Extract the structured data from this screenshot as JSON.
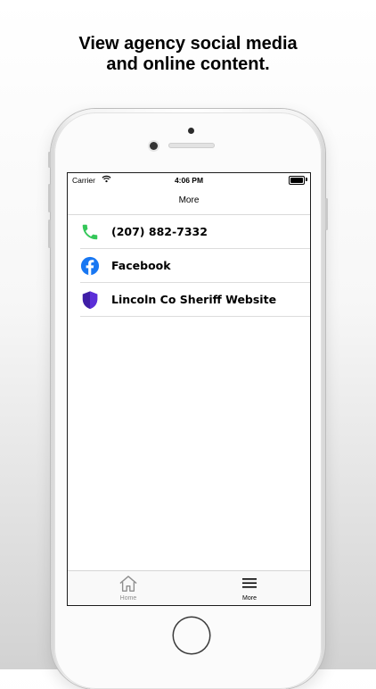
{
  "headline": {
    "line1": "View agency social media",
    "line2": "and online content."
  },
  "status_bar": {
    "carrier": "Carrier",
    "time": "4:06 PM",
    "wifi_icon": "wifi-icon",
    "battery_icon": "battery-icon"
  },
  "nav": {
    "title": "More"
  },
  "list": {
    "items": [
      {
        "label": "(207) 882-7332",
        "icon": "phone-icon",
        "icon_color": "#34c759"
      },
      {
        "label": "Facebook",
        "icon": "facebook-icon",
        "icon_color": "#1877f2"
      },
      {
        "label": "Lincoln Co Sheriff Website",
        "icon": "shield-icon",
        "icon_color": "#3f1ea6"
      }
    ]
  },
  "tab_bar": {
    "tabs": [
      {
        "label": "Home",
        "icon": "home-icon",
        "selected": false
      },
      {
        "label": "More",
        "icon": "menu-icon",
        "selected": true
      }
    ]
  },
  "colors": {
    "selected_tab": "#000000",
    "unselected_tab": "#8e8e8e"
  }
}
